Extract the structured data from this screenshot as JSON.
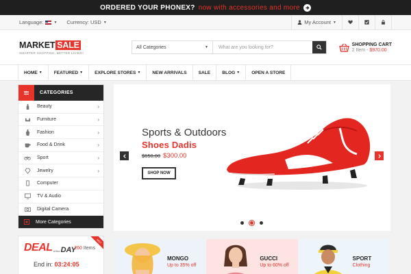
{
  "promo": {
    "text": "ORDERED YOUR PHONEX?",
    "link": "now with accessories  and more"
  },
  "utility": {
    "language_label": "Language:",
    "currency_label": "Currency: USD",
    "account_label": "My Account"
  },
  "header": {
    "logo_main": "MARKET",
    "logo_accent": "SALE",
    "tagline": "SMARTER SHOPPING, BETTER LIVING!",
    "search_category": "All Categories",
    "search_placeholder": "What are you looking for?",
    "cart_title": "SHOPPING CART",
    "cart_items": "2 Item - ",
    "cart_total": "$970.00"
  },
  "nav": {
    "items": [
      {
        "label": "HOME",
        "has_menu": true
      },
      {
        "label": "FEATURED",
        "has_menu": true
      },
      {
        "label": "EXPLORE STORES",
        "has_menu": true
      },
      {
        "label": "NEW ARRIVALS",
        "has_menu": false
      },
      {
        "label": "SALE",
        "has_menu": false
      },
      {
        "label": "BLOG",
        "has_menu": true
      },
      {
        "label": "OPEN A STORE",
        "has_menu": false
      }
    ]
  },
  "categories": {
    "title": "CATEGORIES",
    "items": [
      {
        "label": "Beauty",
        "icon": "beauty-icon",
        "has_sub": true
      },
      {
        "label": "Furniture",
        "icon": "furniture-icon",
        "has_sub": true
      },
      {
        "label": "Fashion",
        "icon": "fashion-icon",
        "has_sub": true
      },
      {
        "label": "Food & Drink",
        "icon": "food-drink-icon",
        "has_sub": true
      },
      {
        "label": "Sport",
        "icon": "sport-icon",
        "has_sub": true
      },
      {
        "label": "Jewelry",
        "icon": "jewelry-icon",
        "has_sub": true
      },
      {
        "label": "Computer",
        "icon": "computer-icon",
        "has_sub": false
      },
      {
        "label": "TV & Audio",
        "icon": "tv-audio-icon",
        "has_sub": false
      },
      {
        "label": "Digital Camera",
        "icon": "camera-icon",
        "has_sub": false
      }
    ],
    "more_label": "More Categories"
  },
  "slider": {
    "subtitle": "Sports & Outdoors",
    "title": "Shoes Dadis",
    "old_price": "$650.00",
    "new_price": "$300.00",
    "button": "SHOP NOW",
    "active_dot": 1
  },
  "deal": {
    "title_big": "DEAL",
    "title_small": "of the",
    "title_day": "DAY",
    "count": "260",
    "count_label": "Items",
    "ribbon": "HOT",
    "end_label": "End in:",
    "time": "03:24:05"
  },
  "banners": [
    {
      "title": "MONGO",
      "subtitle": "Up to 35% off"
    },
    {
      "title": "GUCCI",
      "subtitle": "Up to 60% off"
    },
    {
      "title": "SPORT",
      "subtitle": "Clothing"
    }
  ],
  "colors": {
    "accent": "#e8332a",
    "dark": "#262626"
  }
}
